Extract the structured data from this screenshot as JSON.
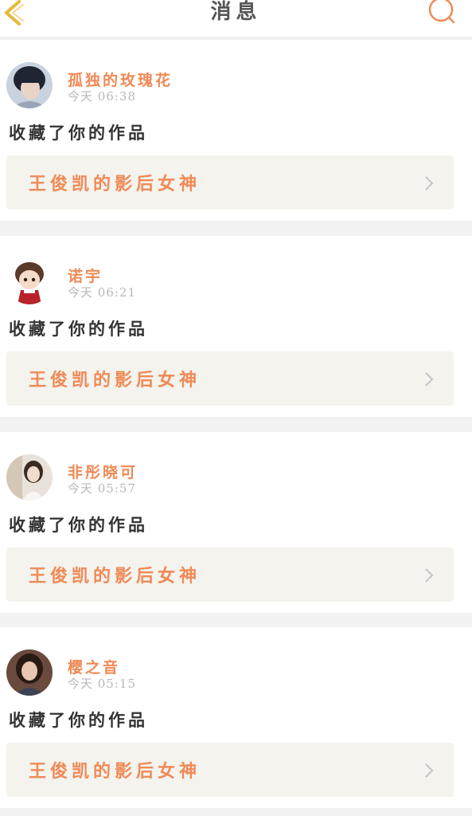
{
  "header": {
    "title": "消息",
    "back_icon": "chevron-left-icon",
    "search_icon": "search-icon"
  },
  "colors": {
    "accent": "#ef8a56",
    "back_arrow": "#e8b83a",
    "action_text": "#333333",
    "timestamp": "#b8b8b8",
    "work_bg": "#f4f3ee"
  },
  "messages": [
    {
      "username": "孤独的玫瑰花",
      "time": "今天 06:38",
      "action": "收藏了你的作品",
      "work_title": "王俊凯的影后女神"
    },
    {
      "username": "诺宇",
      "time": "今天 06:21",
      "action": "收藏了你的作品",
      "work_title": "王俊凯的影后女神"
    },
    {
      "username": "非彤晓可",
      "time": "今天 05:57",
      "action": "收藏了你的作品",
      "work_title": "王俊凯的影后女神"
    },
    {
      "username": "樱之音",
      "time": "今天 05:15",
      "action": "收藏了你的作品",
      "work_title": "王俊凯的影后女神"
    }
  ]
}
